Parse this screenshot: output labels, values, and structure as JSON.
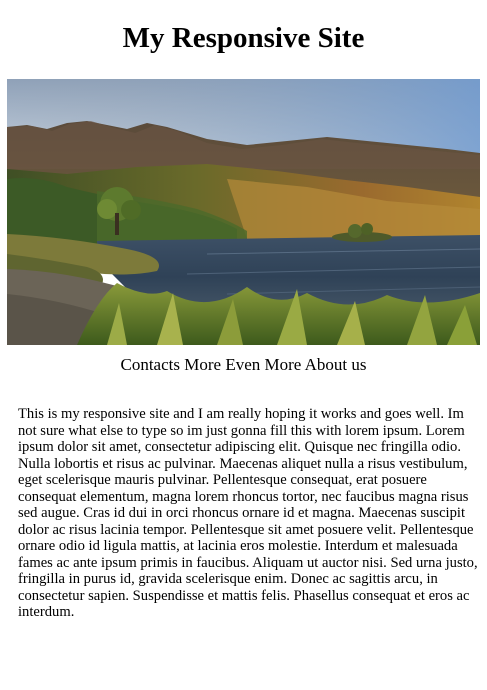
{
  "header": {
    "title": "My Responsive Site"
  },
  "hero": {
    "image": "lake-mountain-landscape"
  },
  "nav": {
    "items": [
      {
        "label": "Contacts"
      },
      {
        "label": "More"
      },
      {
        "label": "Even More"
      },
      {
        "label": "About us"
      }
    ]
  },
  "main": {
    "paragraph": "This is my responsive site and I am really hoping it works and goes well. Im not sure what else to type so im just gonna fill this with lorem ipsum. Lorem ipsum dolor sit amet, consectetur adipiscing elit. Quisque nec fringilla odio. Nulla lobortis et risus ac pulvinar. Maecenas aliquet nulla a risus vestibulum, eget scelerisque mauris pulvinar. Pellentesque consequat, erat posuere consequat elementum, magna lorem rhoncus tortor, nec faucibus magna risus sed augue. Cras id dui in orci rhoncus ornare id et magna. Maecenas suscipit dolor ac risus lacinia tempor. Pellentesque sit amet posuere velit. Pellentesque ornare odio id ligula mattis, at lacinia eros molestie. Interdum et malesuada fames ac ante ipsum primis in faucibus. Aliquam ut auctor nisi. Sed urna justo, fringilla in purus id, gravida scelerisque enim. Donec ac sagittis arcu, in consectetur sapien. Suspendisse et mattis felis. Phasellus consequat et eros ac interdum."
  }
}
